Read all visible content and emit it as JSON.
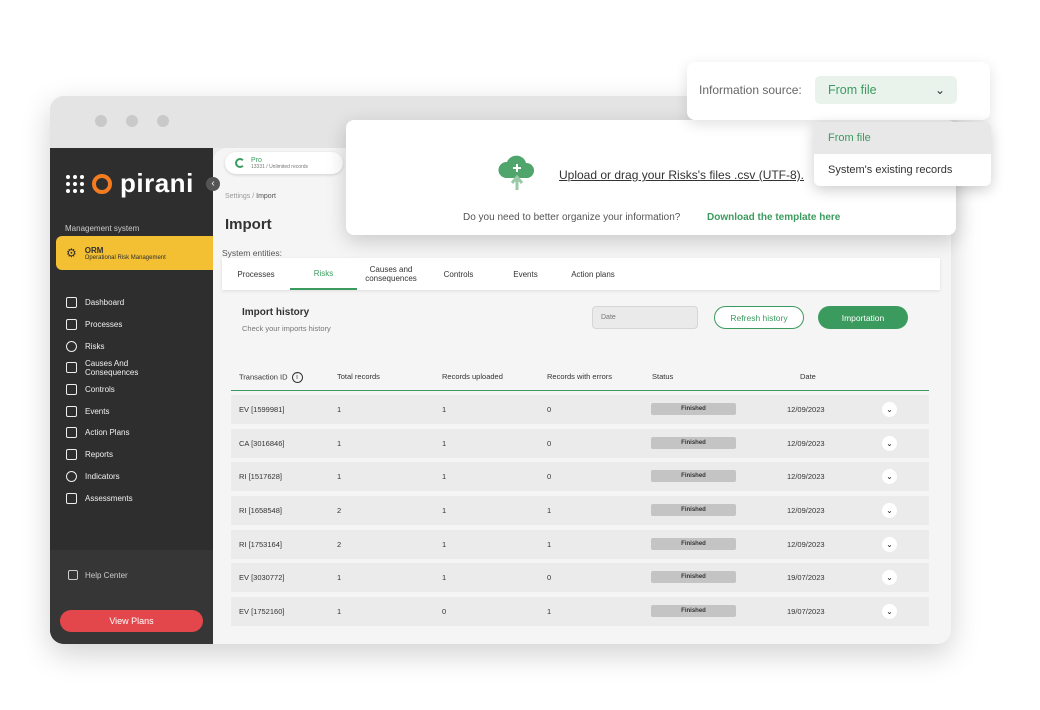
{
  "brand": {
    "name": "pirani"
  },
  "plan": {
    "name": "Pro",
    "records": "13331 / Unlimited records"
  },
  "sidebar": {
    "section_label": "Management system",
    "active_module": {
      "title": "ORM",
      "subtitle": "Operational Risk Management"
    },
    "items": [
      {
        "label": "Dashboard",
        "icon": "monitor-icon"
      },
      {
        "label": "Processes",
        "icon": "list-icon"
      },
      {
        "label": "Risks",
        "icon": "alert-circle-icon"
      },
      {
        "label": "Causes And Consequences",
        "icon": "diagram-icon"
      },
      {
        "label": "Controls",
        "icon": "sliders-icon"
      },
      {
        "label": "Events",
        "icon": "warning-triangle-icon"
      },
      {
        "label": "Action Plans",
        "icon": "checkbox-icon"
      },
      {
        "label": "Reports",
        "icon": "chart-icon"
      },
      {
        "label": "Indicators",
        "icon": "crosshair-icon"
      },
      {
        "label": "Assessments",
        "icon": "checklist-icon"
      }
    ],
    "help_label": "Help Center",
    "view_plans_label": "View Plans"
  },
  "breadcrumb": {
    "parent": "Settings",
    "current": "Import"
  },
  "page": {
    "title": "Import",
    "system_entities_label": "System entities:"
  },
  "tabs": [
    "Processes",
    "Risks",
    "Causes and consequences",
    "Controls",
    "Events",
    "Action plans"
  ],
  "import_history": {
    "title": "Import history",
    "subtitle": "Check your imports history",
    "date_placeholder": "Date",
    "refresh_label": "Refresh history",
    "import_label": "Importation"
  },
  "table": {
    "columns": [
      "Transaction ID",
      "Total records",
      "Records uploaded",
      "Records with errors",
      "Status",
      "Date"
    ],
    "rows": [
      {
        "id": "EV [1599981]",
        "total": "1",
        "uploaded": "1",
        "errors": "0",
        "status": "Finished",
        "date": "12/09/2023"
      },
      {
        "id": "CA [3016846]",
        "total": "1",
        "uploaded": "1",
        "errors": "0",
        "status": "Finished",
        "date": "12/09/2023"
      },
      {
        "id": "RI [1517628]",
        "total": "1",
        "uploaded": "1",
        "errors": "0",
        "status": "Finished",
        "date": "12/09/2023"
      },
      {
        "id": "RI [1658548]",
        "total": "2",
        "uploaded": "1",
        "errors": "1",
        "status": "Finished",
        "date": "12/09/2023"
      },
      {
        "id": "RI [1753164]",
        "total": "2",
        "uploaded": "1",
        "errors": "1",
        "status": "Finished",
        "date": "12/09/2023"
      },
      {
        "id": "EV [3030772]",
        "total": "1",
        "uploaded": "1",
        "errors": "0",
        "status": "Finished",
        "date": "19/07/2023"
      },
      {
        "id": "EV [1752160]",
        "total": "1",
        "uploaded": "0",
        "errors": "1",
        "status": "Finished",
        "date": "19/07/2023"
      }
    ]
  },
  "upload": {
    "link_text": "Upload or drag your Risks's files .csv (UTF-8).",
    "question": "Do you need to better organize your information?",
    "download_text": "Download the template here"
  },
  "source": {
    "label": "Information source:",
    "selected": "From file",
    "options": [
      "From file",
      "System's existing records"
    ]
  },
  "colors": {
    "accent": "#3b9b5e",
    "brand_orange": "#f47b20",
    "active_module": "#f3c034",
    "danger": "#e4474b",
    "sidebar": "#2e2e2e"
  }
}
